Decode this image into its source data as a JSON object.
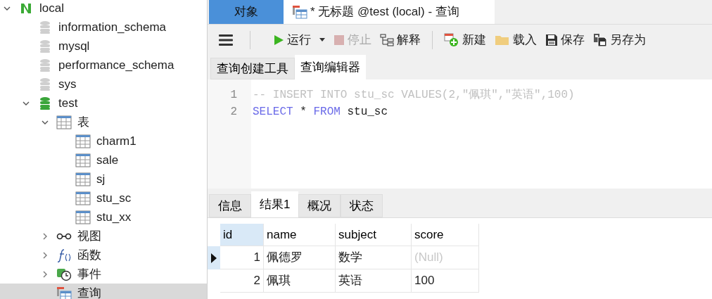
{
  "tree": [
    {
      "label": "local",
      "kind": "connection",
      "expanded": true,
      "selected": false,
      "children": [
        {
          "label": "information_schema",
          "kind": "database",
          "open": false,
          "selected": false
        },
        {
          "label": "mysql",
          "kind": "database",
          "open": false,
          "selected": false
        },
        {
          "label": "performance_schema",
          "kind": "database",
          "open": false,
          "selected": false
        },
        {
          "label": "sys",
          "kind": "database",
          "open": false,
          "selected": false
        },
        {
          "label": "test",
          "kind": "database",
          "open": true,
          "expanded": true,
          "selected": false,
          "children": [
            {
              "label": "表",
              "kind": "tables",
              "expanded": true,
              "selected": false,
              "children": [
                {
                  "label": "charm1",
                  "kind": "table",
                  "selected": false
                },
                {
                  "label": "sale",
                  "kind": "table",
                  "selected": false
                },
                {
                  "label": "sj",
                  "kind": "table",
                  "selected": false
                },
                {
                  "label": "stu_sc",
                  "kind": "table",
                  "selected": false
                },
                {
                  "label": "stu_xx",
                  "kind": "table",
                  "selected": false
                }
              ]
            },
            {
              "label": "视图",
              "kind": "views",
              "expanded": false,
              "selected": false
            },
            {
              "label": "函数",
              "kind": "functions",
              "expanded": false,
              "selected": false
            },
            {
              "label": "事件",
              "kind": "events",
              "expanded": false,
              "selected": false
            },
            {
              "label": "查询",
              "kind": "queries",
              "selected": true
            }
          ]
        }
      ]
    }
  ],
  "window_tabs": [
    {
      "label": "对象",
      "kind": "objects",
      "selected": false
    },
    {
      "label": "* 无标题 @test (local) - 查询",
      "kind": "query",
      "selected": true
    }
  ],
  "toolbar": [
    {
      "label": "运行",
      "kind": "run",
      "disabled": false
    },
    {
      "label": "停止",
      "kind": "stop",
      "disabled": true
    },
    {
      "label": "解释",
      "kind": "explain",
      "disabled": false
    },
    {
      "label": "新建",
      "kind": "new",
      "disabled": false
    },
    {
      "label": "载入",
      "kind": "load",
      "disabled": false
    },
    {
      "label": "保存",
      "kind": "save",
      "disabled": false
    },
    {
      "label": "另存为",
      "kind": "saveas",
      "disabled": false
    }
  ],
  "editor_tabs": [
    {
      "label": "查询创建工具",
      "selected": false
    },
    {
      "label": "查询编辑器",
      "selected": true
    }
  ],
  "editor_lines": [
    {
      "number": "1",
      "tokens": [
        {
          "kind": "comment",
          "text": "-- INSERT INTO stu_sc VALUES(2,\"佩琪\",\"英语\",100)"
        }
      ]
    },
    {
      "number": "2",
      "tokens": [
        {
          "kind": "keyword",
          "text": "SELECT"
        },
        {
          "kind": "plain",
          "text": " * "
        },
        {
          "kind": "keyword",
          "text": "FROM"
        },
        {
          "kind": "plain",
          "text": " stu_sc"
        }
      ]
    }
  ],
  "result_tabs": [
    {
      "label": "信息",
      "selected": false
    },
    {
      "label": "结果1",
      "selected": true
    },
    {
      "label": "概况",
      "selected": false
    },
    {
      "label": "状态",
      "selected": false
    }
  ],
  "grid": {
    "columns": [
      {
        "label": "id",
        "kind": "number",
        "selected": true
      },
      {
        "label": "name",
        "kind": "text",
        "selected": false
      },
      {
        "label": "subject",
        "kind": "text",
        "selected": false
      },
      {
        "label": "score",
        "kind": "text",
        "selected": false
      }
    ],
    "rows": [
      {
        "current": true,
        "cells": [
          {
            "text": "1",
            "null": false
          },
          {
            "text": "佩德罗",
            "null": false
          },
          {
            "text": "数学",
            "null": false
          },
          {
            "text": "(Null)",
            "null": true
          }
        ]
      },
      {
        "current": false,
        "cells": [
          {
            "text": "2",
            "null": false
          },
          {
            "text": "佩琪",
            "null": false
          },
          {
            "text": "英语",
            "null": false
          },
          {
            "text": "100",
            "null": false
          }
        ]
      }
    ]
  }
}
